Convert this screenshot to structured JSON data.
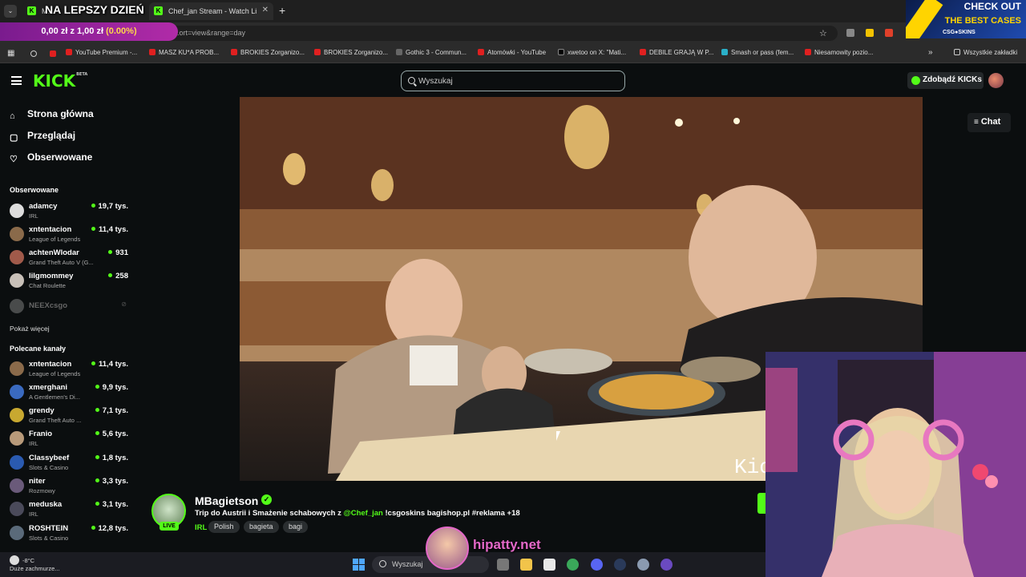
{
  "browser": {
    "tabs": [
      {
        "label": "M...",
        "active": false
      },
      {
        "label": "Chef_jan Stream - Watch Live o",
        "active": true
      }
    ],
    "new_tab": "+",
    "url": "...ort=view&range=day",
    "bookmarks": [
      "YouTube Premium -...",
      "MASZ KU*A PROB...",
      "BROKIES Zorganizo...",
      "BROKIES Zorganizo...",
      "Gothic 3 - Commun...",
      "Atomówki - YouTube",
      "xwetoo on X: \"Mati...",
      "DEBILE GRAJĄ W P...",
      "Smash or pass (fem...",
      "Niesamowity pozio..."
    ],
    "all_bookmarks": "Wszystkie zakładki"
  },
  "overlay": {
    "title": "NA LEPSZY DZIEŃ",
    "donation_text": "0,00 zł z 1,00 zł",
    "donation_pct": "(0.00%)",
    "ad_line1": "CHECK OUT",
    "ad_line2": "THE BEST CASES",
    "ad_brand": "CSG●SKINS",
    "hipatty": "hipatty.net"
  },
  "kick": {
    "logo": "KICK",
    "logo_sup": "BETA",
    "search_placeholder": "Wyszukaj",
    "get_kicks": "Zdobądź KICKs",
    "chat_button": "Chat",
    "nav": [
      {
        "label": "Strona główna",
        "icon": "home-icon"
      },
      {
        "label": "Przeglądaj",
        "icon": "browse-icon"
      },
      {
        "label": "Obserwowane",
        "icon": "heart-icon"
      }
    ],
    "followed_title": "Obserwowane",
    "followed": [
      {
        "name": "adamcy",
        "category": "IRL",
        "viewers": "19,7 tys.",
        "color": "#dddddd"
      },
      {
        "name": "xntentacion",
        "category": "League of Legends",
        "viewers": "11,4 tys.",
        "color": "#8a6a4a"
      },
      {
        "name": "achtenWlodar",
        "category": "Grand Theft Auto V (G...",
        "viewers": "931",
        "color": "#a05a4a"
      },
      {
        "name": "lilgmommey",
        "category": "Chat Roulette",
        "viewers": "258",
        "color": "#c8c0b8"
      }
    ],
    "offline": {
      "name": "NEEXcsgo"
    },
    "show_more": "Pokaż więcej",
    "recommended_title": "Polecane kanały",
    "recommended": [
      {
        "name": "xntentacion",
        "category": "League of Legends",
        "viewers": "11,4 tys.",
        "color": "#8a6a4a"
      },
      {
        "name": "xmerghani",
        "category": "A Gentlemen's Di...",
        "viewers": "9,9 tys.",
        "color": "#3a6ac0"
      },
      {
        "name": "grendy",
        "category": "Grand Theft Auto ...",
        "viewers": "7,1 tys.",
        "color": "#c8a830"
      },
      {
        "name": "Franio",
        "category": "IRL",
        "viewers": "5,6 tys.",
        "color": "#b89a7a"
      },
      {
        "name": "Classybeef",
        "category": "Slots & Casino",
        "viewers": "1,8 tys.",
        "color": "#2a5ab0"
      },
      {
        "name": "niter",
        "category": "Rozmowy",
        "viewers": "3,3 tys.",
        "color": "#6a5a7a"
      },
      {
        "name": "meduska",
        "category": "IRL",
        "viewers": "3,1 tys.",
        "color": "#4a4a5a"
      },
      {
        "name": "ROSHTEIN",
        "category": "Slots & Casino",
        "viewers": "12,8 tys.",
        "color": "#5a6a7a"
      }
    ],
    "stream": {
      "streamer": "MBagietson",
      "live": "LIVE",
      "title_pre": "Trip do Austrii  i Smażenie schabowych z ",
      "title_mention": "@Chef_jan",
      "title_post": " !csgoskins bagishop.pl #reklama +18",
      "category": "IRL",
      "tags": [
        "Polish",
        "bagieta",
        "bagi"
      ],
      "video_watermark": "Kic"
    }
  },
  "taskbar": {
    "temp": "-8°C",
    "weather": "Duże zachmurze...",
    "search": "Wyszukaj"
  }
}
